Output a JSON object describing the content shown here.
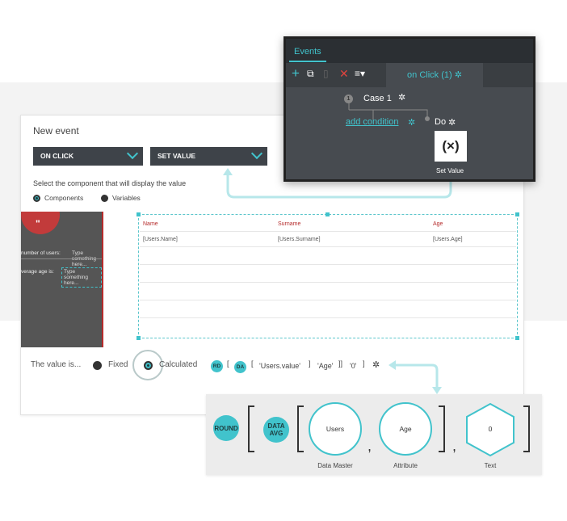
{
  "event_panel": {
    "title": "New event",
    "trigger_dropdown": "ON CLICK",
    "action_dropdown": "SET VALUE",
    "instruction": "Select the component that will display the value",
    "radio_components": "Components",
    "radio_variables": "Variables"
  },
  "preview": {
    "field1_label": "number of users:",
    "field1_placeholder": "Type something here...",
    "field2_label": "verage age is:",
    "field2_placeholder": "Type something here..."
  },
  "table": {
    "headers": [
      "Name",
      "Surname",
      "Age"
    ],
    "row": [
      "[Users.Name]",
      "[Users.Surname]",
      "[Users.Age]"
    ]
  },
  "value_row": {
    "label": "The value is...",
    "fixed": "Fixed",
    "calculated": "Calculated",
    "badge_rd": "RD",
    "badge_da": "DA",
    "open_bracket_1": "[",
    "open_bracket_2": "[",
    "arg_users": "'Users.value'",
    "close_bracket_1": "]",
    "arg_age": "'Age'",
    "close_brackets": "]]",
    "arg_zero": "'0'",
    "close_bracket_final": "]"
  },
  "events_panel": {
    "tab": "Events",
    "case_tab": "on Click (1)",
    "case_label": "Case 1",
    "case_number": "1",
    "add_condition": "add condition",
    "do_label": "Do",
    "set_value_icon": "(×)",
    "set_value_label": "Set Value",
    "toolbar_icons": [
      "plus-icon",
      "duplicate-icon",
      "clipboard-icon",
      "delete-icon",
      "list-menu-icon"
    ]
  },
  "formula_panel": {
    "round_badge": "ROUND",
    "data_avg_badge_line1": "DATA",
    "data_avg_badge_line2": "AVG",
    "users_node": "Users",
    "users_caption": "Data Master",
    "age_node": "Age",
    "age_caption": "Attribute",
    "zero_node": "0",
    "zero_caption": "Text",
    "comma": ","
  },
  "colors": {
    "accent": "#41c3cc",
    "dark_panel": "#2b2f33",
    "dropdown_bg": "#3e4349",
    "header_red": "#b52b2b"
  }
}
